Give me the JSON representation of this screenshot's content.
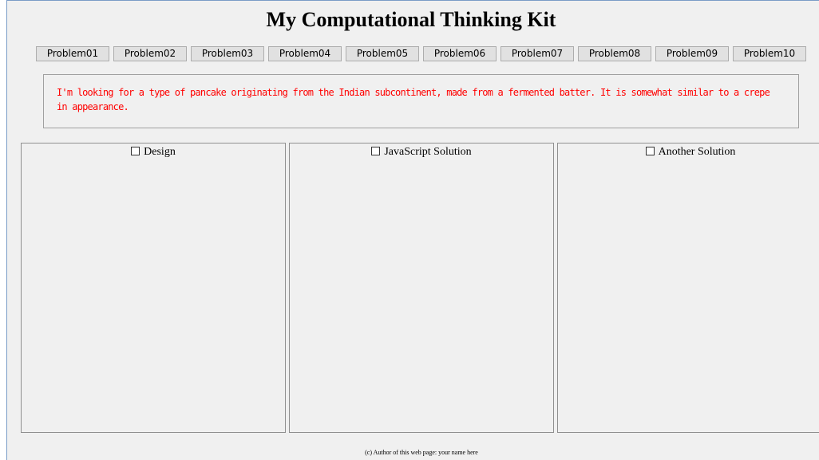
{
  "header": {
    "title": "My Computational Thinking Kit"
  },
  "problem_buttons": [
    "Problem01",
    "Problem02",
    "Problem03",
    "Problem04",
    "Problem05",
    "Problem06",
    "Problem07",
    "Problem08",
    "Problem09",
    "Problem10"
  ],
  "problem": {
    "text": "I'm looking for a type of pancake originating from the Indian subcontinent, made from a fermented batter. It is somewhat similar to a crepe in appearance.",
    "color": "#ff0000"
  },
  "panels": {
    "design": {
      "label": "Design"
    },
    "javascript": {
      "label": "JavaScript Solution"
    },
    "another": {
      "label": "Another Solution"
    }
  },
  "footer": {
    "text": "(c) Author of this web page: your name here"
  }
}
